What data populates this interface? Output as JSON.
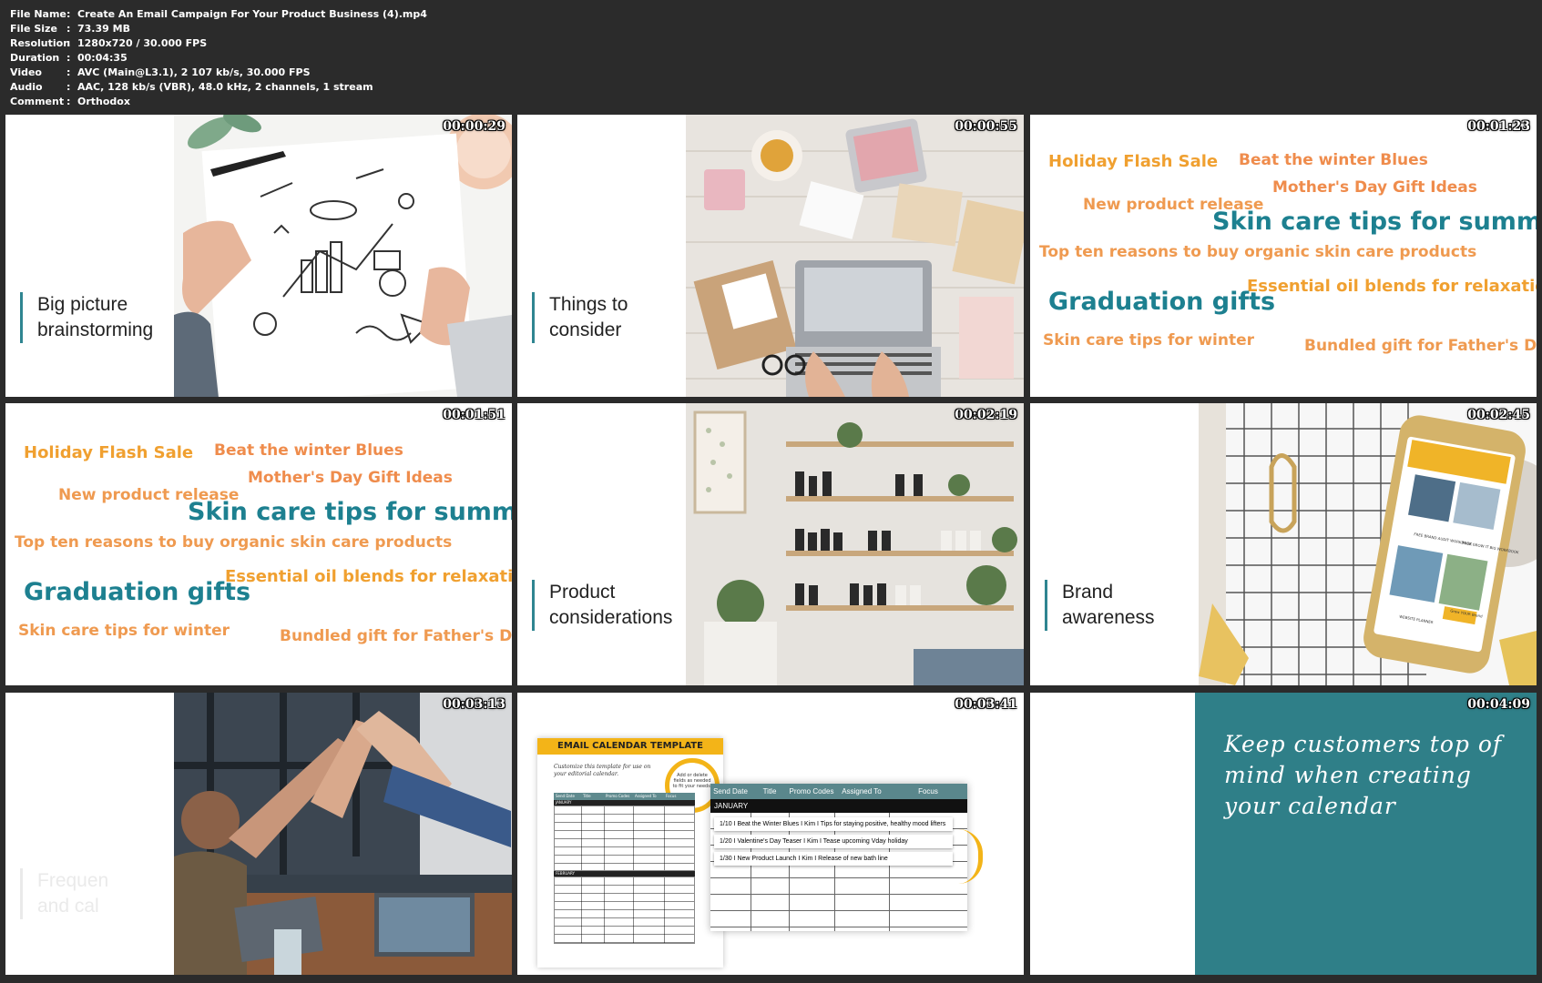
{
  "meta": [
    {
      "key": "File Name",
      "value": "Create An Email Campaign For Your Product Business (4).mp4"
    },
    {
      "key": "File Size",
      "value": "73.39 MB"
    },
    {
      "key": "Resolution",
      "value": "1280x720 / 30.000 FPS"
    },
    {
      "key": "Duration",
      "value": "00:04:35"
    },
    {
      "key": "Video",
      "value": "AVC (Main@L3.1), 2 107 kb/s, 30.000 FPS"
    },
    {
      "key": "Audio",
      "value": "AAC, 128 kb/s (VBR), 48.0 kHz, 2 channels, 1 stream"
    },
    {
      "key": "Comment",
      "value": "Orthodox"
    }
  ],
  "thumbnails": [
    {
      "time": "00:00:29",
      "title": [
        "Big picture",
        "brainstorming"
      ]
    },
    {
      "time": "00:00:55",
      "title": [
        "Things to",
        "consider"
      ]
    },
    {
      "time": "00:01:23"
    },
    {
      "time": "00:01:51"
    },
    {
      "time": "00:02:19",
      "title": [
        "Product",
        "considerations"
      ]
    },
    {
      "time": "00:02:45",
      "title": [
        "Brand",
        "awareness"
      ]
    },
    {
      "time": "00:03:13",
      "title": [
        "Frequen",
        "and cal"
      ]
    },
    {
      "time": "00:03:41"
    },
    {
      "time": "00:04:09"
    }
  ],
  "wordcloud": {
    "holiday": "Holiday Flash Sale",
    "winter_blues": "Beat the winter Blues",
    "mothers_day": "Mother's Day Gift Ideas",
    "new_product": "New product release",
    "skin_summer": "Skin care tips for summer",
    "top_ten": "Top ten reasons to buy organic skin care products",
    "essential_oil": "Essential oil blends for relaxation",
    "graduation": "Graduation gifts",
    "skin_winter": "Skin care tips for winter",
    "fathers_day": "Bundled gift for Father's Day"
  },
  "calendar": {
    "heading": "EMAIL CALENDAR TEMPLATE",
    "subtitle": "Customize this template for use on your editorial calendar.",
    "note": "Add or delete fields as needed to fit your needs.",
    "small_headers": [
      "Send Date",
      "Title",
      "Promo Codes",
      "Assigned To",
      "Focus"
    ],
    "small_months": [
      "JANUARY",
      "FEBRUARY"
    ],
    "big_headers": [
      "Send Date",
      "Title",
      "Promo Codes",
      "Assigned To",
      "Focus"
    ],
    "big_month": "JANUARY",
    "entries": [
      "1/10 I Beat the Winter Blues I Kim I Tips for staying positive, healthy mood lifters",
      "1/20 I Valentine's Day Teaser I Kim I Tease upcoming Vday holiday",
      "1/30 I New Product Launch I Kim I Release of new bath line"
    ]
  },
  "phone_screen": {
    "brand": "WEBSITE PLANNER",
    "cta1": "FREE BRAND AUDIT WORKBOOK",
    "cta2": "FREE GROW IT BIG WORKBOOK",
    "button": "Grow YOUR Brand"
  },
  "quote": "Keep customers top of mind when creating your calendar"
}
